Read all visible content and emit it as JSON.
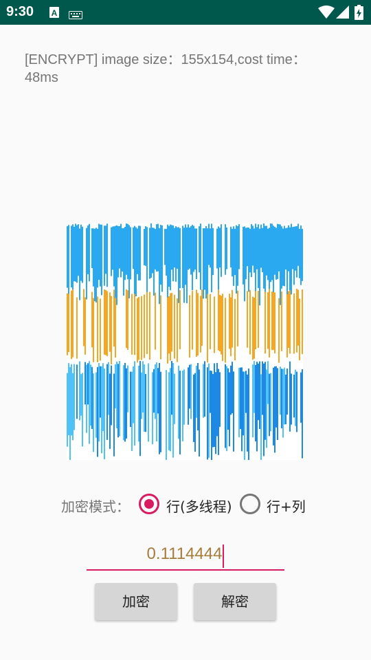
{
  "status_bar": {
    "time": "9:30",
    "left_icons": [
      "a-notification-icon",
      "keyboard-icon"
    ],
    "right_icons": [
      "wifi-icon",
      "cell-signal-icon",
      "battery-icon"
    ],
    "background": "#00574b"
  },
  "info": {
    "text": "[ENCRYPT]  image size：155x154,cost time：48ms"
  },
  "encrypted_image": {
    "colors": [
      "#2aa8f0",
      "#f5a623",
      "#4fc3f7",
      "#1e88e5",
      "#ffffff"
    ]
  },
  "mode": {
    "label": "加密模式：",
    "options": [
      {
        "label": "行(多线程)",
        "selected": true
      },
      {
        "label": "行+列",
        "selected": false
      }
    ]
  },
  "key_input": {
    "value": "0.1114444"
  },
  "buttons": {
    "encrypt": "加密",
    "decrypt": "解密"
  },
  "colors": {
    "accent": "#d81b60",
    "input_text": "#a67c3c",
    "button_bg": "#d6d6d6"
  }
}
